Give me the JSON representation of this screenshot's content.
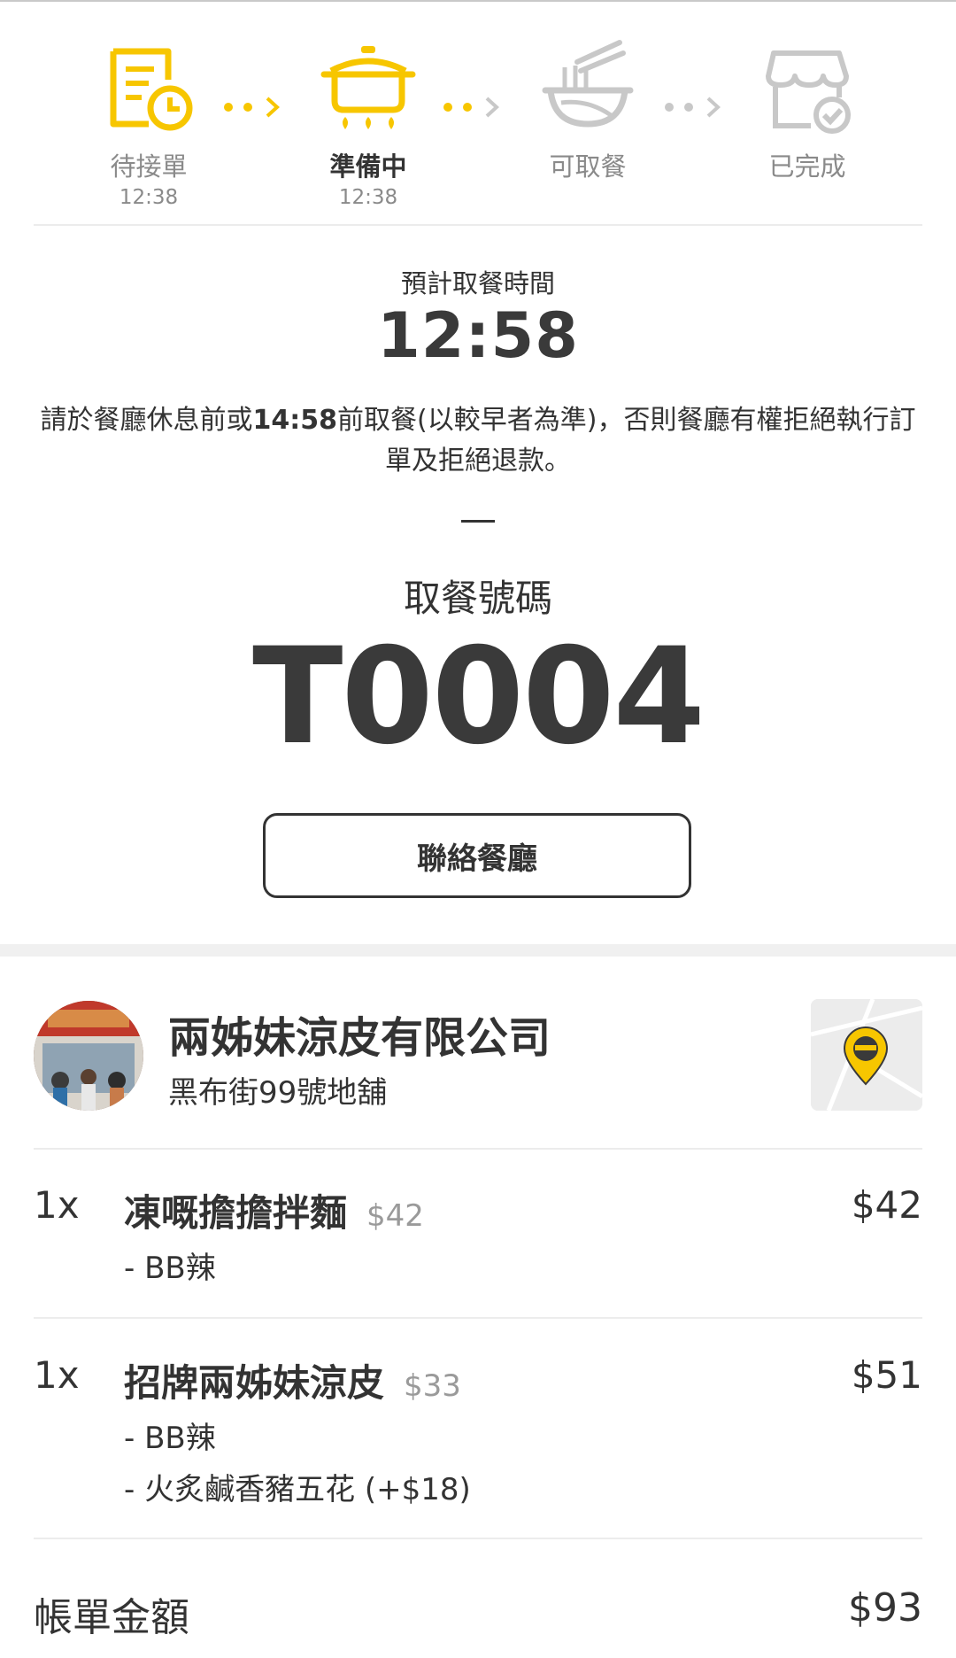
{
  "colors": {
    "accent": "#f7c600",
    "inactive": "#c8c8c8",
    "text": "#333333",
    "muted": "#8a8a8a"
  },
  "progress": {
    "steps": [
      {
        "label": "待接單",
        "time": "12:38",
        "icon": "order-receipt-clock-icon",
        "state": "done"
      },
      {
        "label": "準備中",
        "time": "12:38",
        "icon": "cooking-pot-icon",
        "state": "active"
      },
      {
        "label": "可取餐",
        "time": "",
        "icon": "noodle-bowl-icon",
        "state": "pending"
      },
      {
        "label": "已完成",
        "time": "",
        "icon": "store-check-icon",
        "state": "pending"
      }
    ]
  },
  "pickup": {
    "eta_label": "預計取餐時間",
    "eta_time": "12:58",
    "notice_prefix": "請於餐廳休息前或",
    "notice_bold": "14:58",
    "notice_suffix": "前取餐(以較早者為準)，否則餐廳有權拒絕執行訂單及拒絕退款。",
    "number_label": "取餐號碼",
    "number": "T0004",
    "contact_button": "聯絡餐廳"
  },
  "restaurant": {
    "name": "兩姊妹涼皮有限公司",
    "address": "黑布街99號地舖",
    "map_icon": "map-pin-icon"
  },
  "items": [
    {
      "qty": "1x",
      "name": "凍嘅擔擔拌麵",
      "unit_price": "$42",
      "total": "$42",
      "options": [
        "- BB辣"
      ]
    },
    {
      "qty": "1x",
      "name": "招牌兩姊妹涼皮",
      "unit_price": "$33",
      "total": "$51",
      "options": [
        "- BB辣",
        "- 火炙鹹香豬五花 (+$18)"
      ]
    }
  ],
  "bill": {
    "label": "帳單金額",
    "amount": "$93"
  }
}
